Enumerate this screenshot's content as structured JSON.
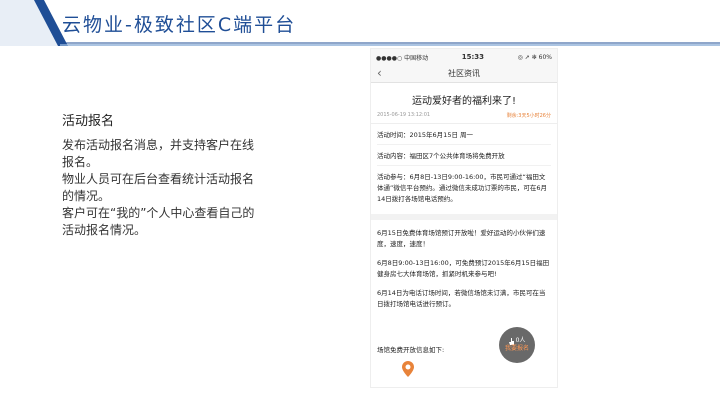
{
  "slide": {
    "title": "云物业-极致社区C端平台"
  },
  "feature": {
    "heading": "活动报名",
    "lines": [
      "发布活动报名消息，并支持客户在线报名。",
      "物业人员可在后台查看统计活动报名的情况。",
      "客户可在“我的”个人中心查看自己的活动报名情况。"
    ]
  },
  "phone": {
    "status_bar": {
      "carrier": "●●●●○ 中国移动 ",
      "time": "15:33",
      "battery": "◎ ➚ ✻ 60%"
    },
    "nav": {
      "back": "‹",
      "title": "社区资讯"
    },
    "article": {
      "title": "运动爱好者的福利来了!",
      "date": "2015-06-19 13:12:01",
      "remaining": "剩余:3天5小时26分",
      "info": [
        "活动时间：2015年6月15日 周一",
        "活动内容：福田区7个公共体育场将免费开放",
        "活动参与：6月8日-13日9:00-16:00，市民可通过“福田文体通”微信平台预约。通过微信未成功订票的市民，可在6月14日拨打各场馆电话预约。"
      ],
      "paragraphs": [
        "6月15日免费体育场馆预订开放啦！爱好运动的小伙伴们速度，速度，速度！",
        "6月8日9:00-13日16:00，可免费预订2015年6月15日福田健身房七大体育场馆，抓紧时机来参与吧!",
        "6月14日为电话订场时间，若微信场馆未订满，市民可在当日拨打场馆电话进行预订。"
      ],
      "venue_title": "场馆免费开放信息如下:"
    },
    "float_button": {
      "count": "0人",
      "label": "我要报名"
    }
  },
  "colors": {
    "title_blue": "#1f4e96",
    "header_dark": "#1f4e96",
    "header_light": "#8fb0d8",
    "accent_orange": "#e8833a"
  }
}
